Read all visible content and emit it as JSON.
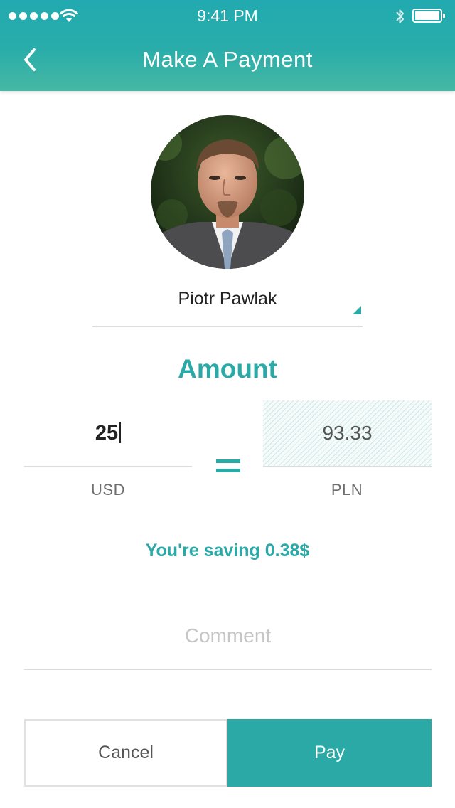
{
  "status_bar": {
    "signal_icon": "signal-dots-icon",
    "wifi_icon": "wifi-icon",
    "time": "9:41 PM",
    "bluetooth_icon": "bluetooth-icon",
    "battery_icon": "battery-icon"
  },
  "header": {
    "back_icon": "chevron-left-icon",
    "title": "Make A Payment"
  },
  "recipient": {
    "name": "Piotr Pawlak",
    "dropdown_icon": "dropdown-triangle-icon"
  },
  "amount": {
    "label": "Amount",
    "from_value": "25",
    "from_currency": "USD",
    "equals_icon": "equals-icon",
    "to_value": "93.33",
    "to_currency": "PLN"
  },
  "saving_text": "You're saving 0.38$",
  "comment": {
    "placeholder": "Comment"
  },
  "buttons": {
    "cancel": "Cancel",
    "pay": "Pay"
  },
  "colors": {
    "accent": "#2aa9a6",
    "header_top": "#21aab0",
    "header_bottom": "#46b8a3"
  }
}
